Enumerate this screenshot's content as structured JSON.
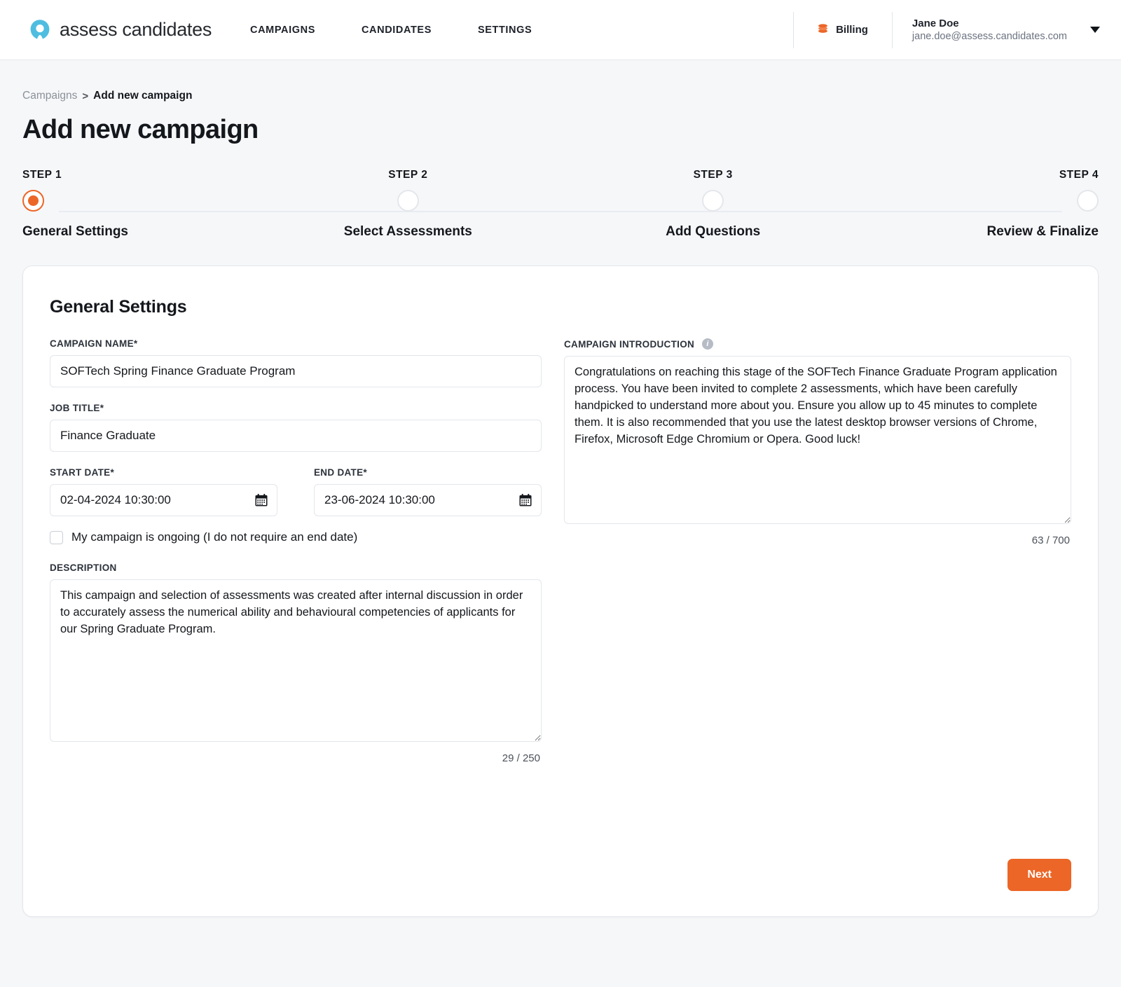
{
  "brand": {
    "name": "assess candidates",
    "logo_icon": "teardrop-pin-icon",
    "color": "#4fbde0"
  },
  "nav": {
    "items": [
      {
        "label": "CAMPAIGNS"
      },
      {
        "label": "CANDIDATES"
      },
      {
        "label": "SETTINGS"
      }
    ]
  },
  "account": {
    "billing_label": "Billing",
    "billing_icon": "coins-stack-icon",
    "user_name": "Jane Doe",
    "user_email": "jane.doe@assess.candidates.com",
    "caret_icon": "chevron-down-icon"
  },
  "breadcrumb": {
    "parent": "Campaigns",
    "separator": ">",
    "current": "Add new campaign"
  },
  "page_title": "Add new campaign",
  "stepper": {
    "steps": [
      {
        "num": "STEP 1",
        "label": "General Settings",
        "active": true
      },
      {
        "num": "STEP 2",
        "label": "Select Assessments",
        "active": false
      },
      {
        "num": "STEP 3",
        "label": "Add Questions",
        "active": false
      },
      {
        "num": "STEP 4",
        "label": "Review & Finalize",
        "active": false
      }
    ],
    "accent_color": "#ec6627"
  },
  "form": {
    "card_title": "General Settings",
    "campaign_name": {
      "label": "CAMPAIGN NAME*",
      "value": "SOFTech Spring Finance Graduate Program",
      "placeholder": "Campaign name"
    },
    "job_title": {
      "label": "JOB TITLE*",
      "value": "Finance Graduate",
      "placeholder": "Job title"
    },
    "start_date": {
      "label": "START DATE*",
      "value": "02-04-2024 10:30:00",
      "icon": "calendar-icon"
    },
    "end_date": {
      "label": "END DATE*",
      "value": "23-06-2024 10:30:00",
      "icon": "calendar-icon"
    },
    "ongoing_checkbox": {
      "label": "My campaign is ongoing (I do not require an end date)",
      "checked": false
    },
    "description": {
      "label": "DESCRIPTION",
      "value": "This campaign and selection of assessments was created after internal discussion in order to accurately assess the numerical ability and behavioural competencies of applicants for our Spring Graduate Program.",
      "counter": "29 / 250"
    },
    "campaign_introduction": {
      "label": "CAMPAIGN INTRODUCTION",
      "info_icon": "info-icon",
      "value": "Congratulations on reaching this stage of the SOFTech Finance Graduate Program application process. You have been invited to complete 2 assessments, which have been carefully handpicked to understand more about you. Ensure you allow up to 45 minutes to complete them. It is also recommended that you use the latest desktop browser versions of Chrome, Firefox, Microsoft Edge Chromium or Opera. Good luck!",
      "counter": "63 / 700"
    },
    "next_button": "Next"
  }
}
